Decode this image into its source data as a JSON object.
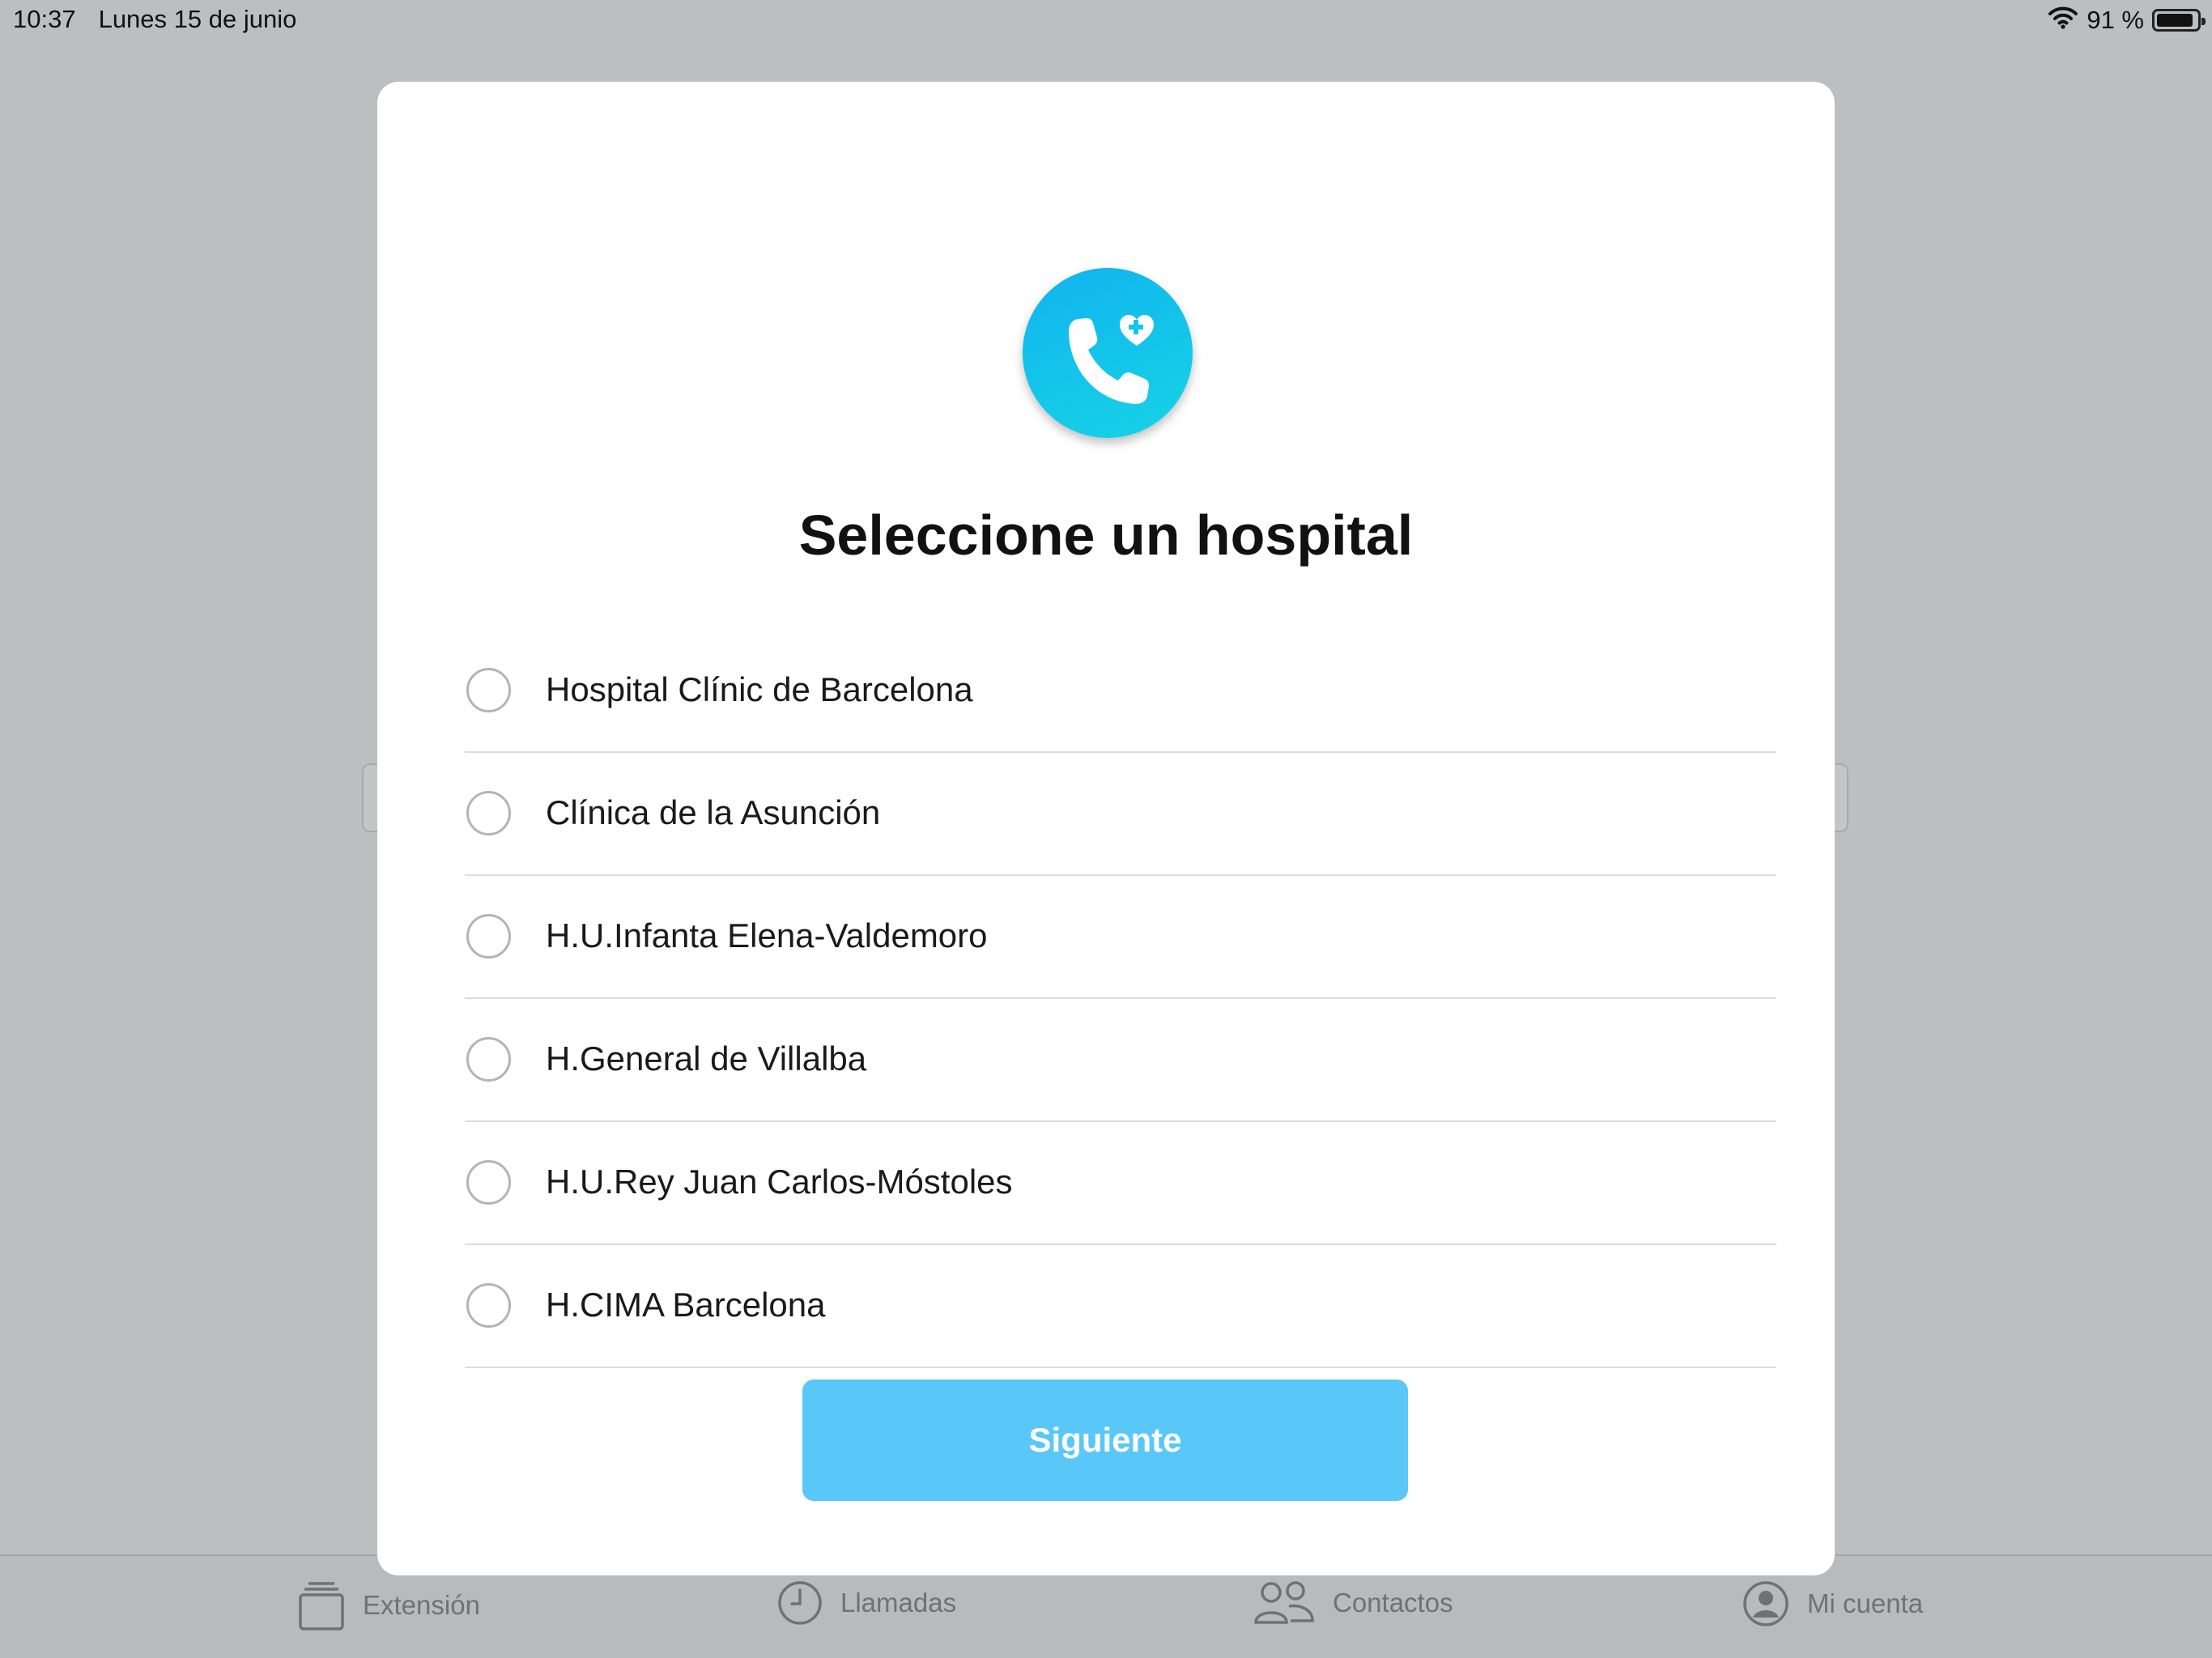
{
  "status_bar": {
    "time": "10:37",
    "date": "Lunes 15 de junio",
    "battery_text": "91 %",
    "battery_level": 0.91
  },
  "modal": {
    "title": "Seleccione un hospital",
    "options": [
      {
        "label": "Hospital Clínic de Barcelona",
        "selected": false
      },
      {
        "label": "Clínica de la Asunción",
        "selected": false
      },
      {
        "label": "H.U.Infanta Elena-Valdemoro",
        "selected": false
      },
      {
        "label": "H.General de Villalba",
        "selected": false
      },
      {
        "label": "H.U.Rey Juan Carlos-Móstoles",
        "selected": false
      },
      {
        "label": "H.CIMA Barcelona",
        "selected": false
      }
    ],
    "next_label": "Siguiente",
    "logo_icon": "phone-heart-icon"
  },
  "tab_bar": {
    "tabs": [
      {
        "label": "Extensión",
        "icon": "extension-icon"
      },
      {
        "label": "Llamadas",
        "icon": "clock-icon"
      },
      {
        "label": "Contactos",
        "icon": "contacts-icon"
      },
      {
        "label": "Mi cuenta",
        "icon": "account-icon"
      }
    ]
  },
  "colors": {
    "accent": "#5ac7f9",
    "logo_gradient_start": "#11b4ee",
    "logo_gradient_end": "#17d3e6",
    "overlay": "#bdbec0"
  }
}
